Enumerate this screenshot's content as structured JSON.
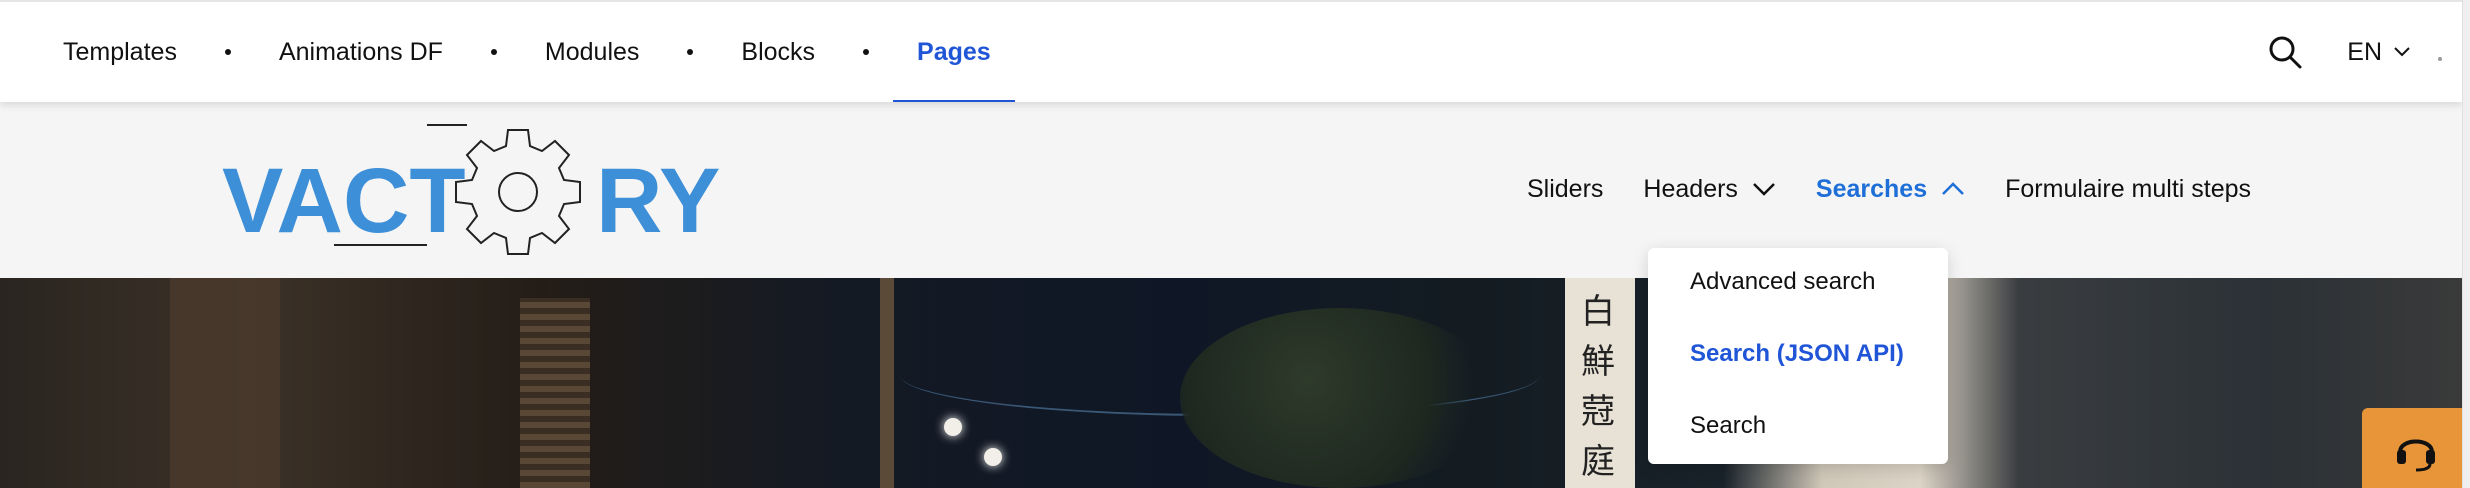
{
  "topnav": {
    "items": [
      {
        "label": "Templates",
        "active": false
      },
      {
        "label": "Animations DF",
        "active": false
      },
      {
        "label": "Modules",
        "active": false
      },
      {
        "label": "Blocks",
        "active": false
      },
      {
        "label": "Pages",
        "active": true
      }
    ],
    "search_icon": "search-icon",
    "language": "EN",
    "language_icon": "chevron-down-icon"
  },
  "logo": {
    "text_left": "VACT",
    "text_right": "RY",
    "gear_icon": "gear-icon",
    "color": "#3d8fd8"
  },
  "mainnav": {
    "items": [
      {
        "label": "Sliders",
        "has_dropdown": false,
        "active": false
      },
      {
        "label": "Headers",
        "has_dropdown": true,
        "active": false,
        "icon": "chevron-down-icon"
      },
      {
        "label": "Searches",
        "has_dropdown": true,
        "active": true,
        "icon": "chevron-up-icon"
      },
      {
        "label": "Formulaire multi steps",
        "has_dropdown": false,
        "active": false
      }
    ]
  },
  "dropdown": {
    "items": [
      {
        "label": "Advanced search",
        "active": false
      },
      {
        "label": "Search (JSON API)",
        "active": true
      },
      {
        "label": "Search",
        "active": false
      }
    ]
  },
  "hero": {
    "sign_chars": [
      "白",
      "鮮",
      "蒄",
      "庭"
    ]
  },
  "support_button": {
    "icon": "headset-icon",
    "color": "#e8953a"
  },
  "colors": {
    "accent": "#1f55d6",
    "logo": "#3d8fd8",
    "header_bg": "#f5f5f5"
  }
}
